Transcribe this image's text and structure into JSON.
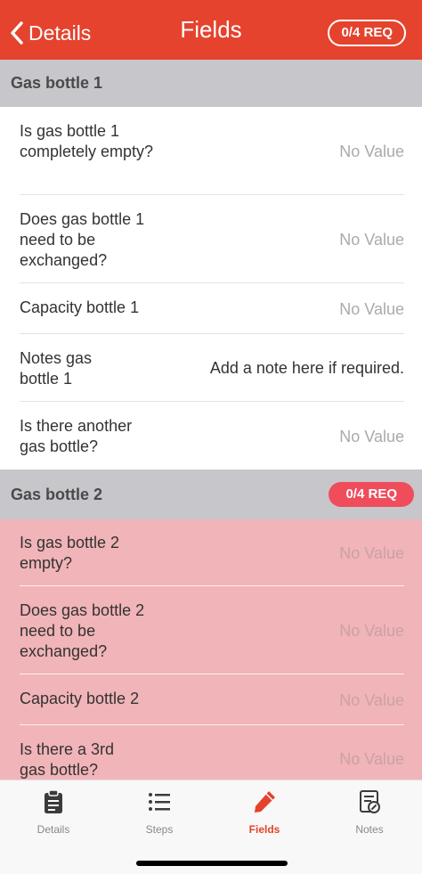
{
  "header": {
    "back_label": "Details",
    "title": "Fields",
    "req_badge": "0/4 REQ"
  },
  "sections": [
    {
      "title": "Gas bottle 1",
      "fields": [
        {
          "label": "Is gas bottle 1 completely empty?",
          "value": "No Value"
        },
        {
          "label": "Does gas bottle 1 need to be exchanged?",
          "value": "No Value"
        },
        {
          "label": "Capacity bottle 1",
          "value": "No Value"
        },
        {
          "label": "Notes gas bottle 1",
          "value": "Add a note here if required."
        },
        {
          "label": "Is there another gas bottle?",
          "value": "No Value"
        }
      ]
    },
    {
      "title": "Gas bottle 2",
      "req_badge": "0/4 REQ",
      "fields": [
        {
          "label": "Is gas bottle 2 empty?",
          "value": "No Value"
        },
        {
          "label": "Does gas bottle 2 need to be exchanged?",
          "value": "No Value"
        },
        {
          "label": "Capacity bottle 2",
          "value": "No Value"
        },
        {
          "label": "Is there a 3rd gas bottle?",
          "value": "No Value"
        }
      ]
    }
  ],
  "tabs": [
    {
      "label": "Details",
      "icon": "clipboard-icon"
    },
    {
      "label": "Steps",
      "icon": "list-icon"
    },
    {
      "label": "Fields",
      "icon": "pencil-icon",
      "active": true
    },
    {
      "label": "Notes",
      "icon": "notes-icon"
    }
  ],
  "colors": {
    "header": "#e5432d",
    "section_header": "#c7c6cb",
    "required_section": "#f1b4b8",
    "required_badge": "#ef4d5c",
    "active_tab": "#e5432d"
  }
}
